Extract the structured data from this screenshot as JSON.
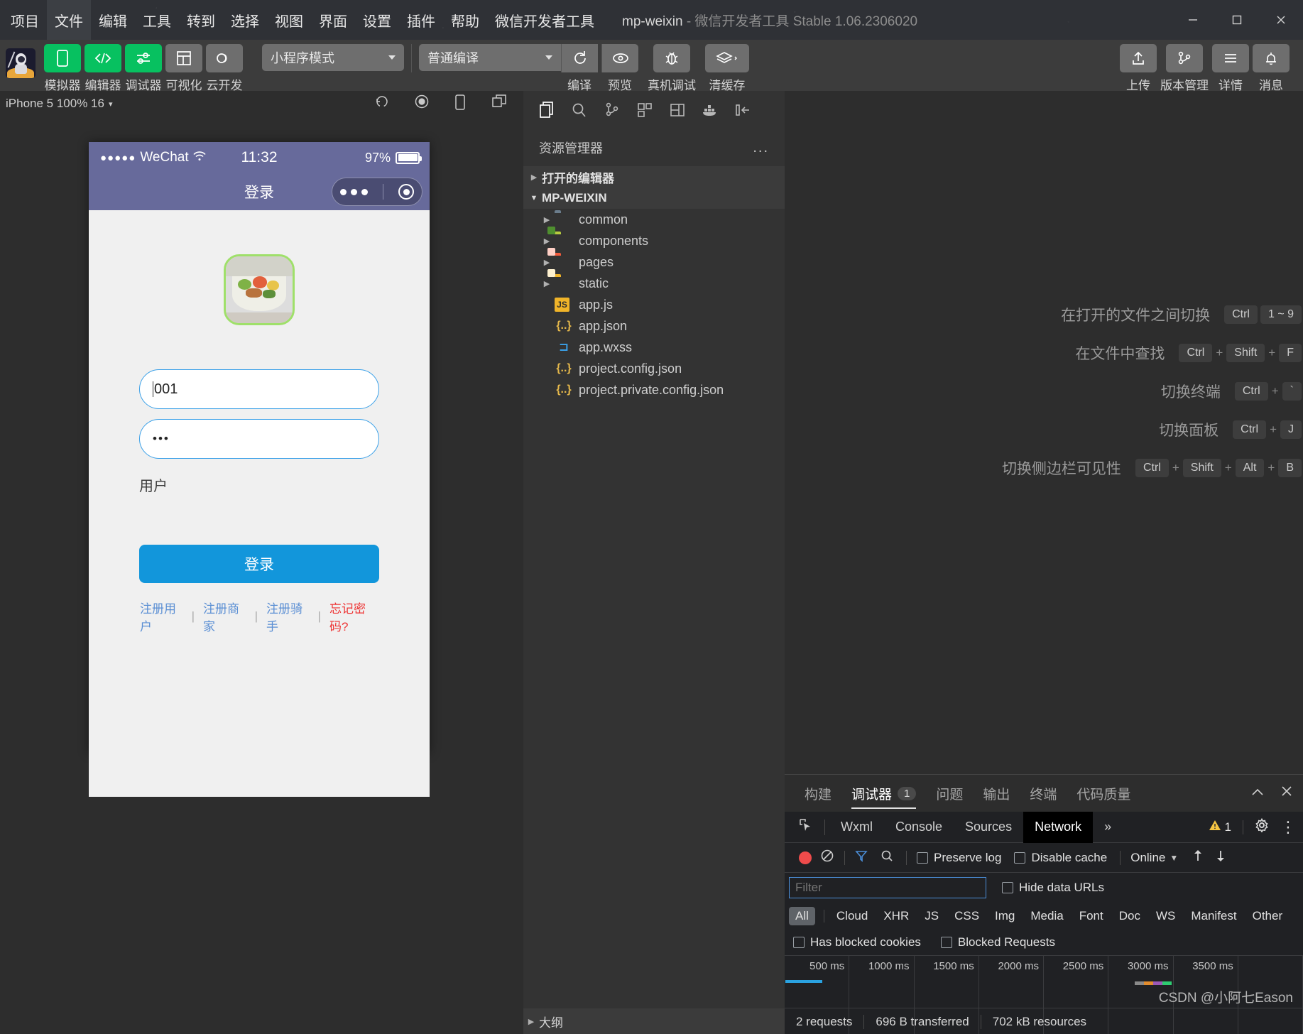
{
  "titlebar": {
    "menus": [
      "项目",
      "文件",
      "编辑",
      "工具",
      "转到",
      "选择",
      "视图",
      "界面",
      "设置",
      "插件",
      "帮助",
      "微信开发者工具"
    ],
    "active_menu": "文件",
    "project_name": "mp-weixin",
    "title_suffix": "- 微信开发者工具 Stable 1.06.2306020",
    "window_minimize": "—",
    "window_maximize": "▢",
    "window_close": "✕"
  },
  "toolbar": {
    "left_buttons": [
      {
        "label": "模拟器",
        "icon": "phone-icon",
        "color": "green"
      },
      {
        "label": "编辑器",
        "icon": "code-icon",
        "color": "green"
      },
      {
        "label": "调试器",
        "icon": "sliders-icon",
        "color": "green"
      },
      {
        "label": "可视化",
        "icon": "layout-icon",
        "color": "grey"
      },
      {
        "label": "云开发",
        "icon": "cloud-icon",
        "color": "grey"
      }
    ],
    "mode_select": "小程序模式",
    "compile_select": "普通编译",
    "actions": [
      {
        "label": "编译",
        "icon": "refresh-icon"
      },
      {
        "label": "预览",
        "icon": "eye-icon"
      },
      {
        "label": "真机调试",
        "icon": "bug-icon"
      },
      {
        "label": "清缓存",
        "icon": "layers-icon"
      }
    ],
    "right_buttons": [
      {
        "label": "上传",
        "icon": "upload-icon"
      },
      {
        "label": "版本管理",
        "icon": "branch-icon"
      },
      {
        "label": "详情",
        "icon": "menu-icon"
      },
      {
        "label": "消息",
        "icon": "bell-icon"
      }
    ]
  },
  "simulator": {
    "device_info": "iPhone 5 100% 16",
    "toolbar_icons": [
      "rotate-icon",
      "record-icon",
      "device-icon",
      "window-icon"
    ],
    "status_bar": {
      "carrier_dots": "●●●●●",
      "carrier": "WeChat",
      "wifi": "wifi-icon",
      "time": "11:32",
      "battery_pct": "97%"
    },
    "nav_title": "登录",
    "form": {
      "username_value": "001",
      "password_value": "•••",
      "user_label": "用户",
      "login_button": "登录"
    },
    "links": [
      {
        "label": "注册用户",
        "style": "normal"
      },
      {
        "label": "注册商家",
        "style": "normal"
      },
      {
        "label": "注册骑手",
        "style": "normal"
      },
      {
        "label": "忘记密码?",
        "style": "warn"
      }
    ]
  },
  "explorer": {
    "activity_icons": [
      "files-icon",
      "search-icon",
      "source-control-icon",
      "extensions-icon",
      "layout-icon",
      "docker-icon",
      "collapse-icon"
    ],
    "title": "资源管理器",
    "more_label": "...",
    "sections": [
      {
        "label": "打开的编辑器",
        "expanded": false
      },
      {
        "label": "MP-WEIXIN",
        "expanded": true
      }
    ],
    "tree": [
      {
        "label": "common",
        "type": "folder",
        "color": "#6b7d8c",
        "expanded": false
      },
      {
        "label": "components",
        "type": "folder",
        "color": "#b7cc3f",
        "expanded": false
      },
      {
        "label": "pages",
        "type": "folder",
        "color": "#f45b3c",
        "expanded": false
      },
      {
        "label": "static",
        "type": "folder",
        "color": "#f0b429",
        "expanded": false
      },
      {
        "label": "app.js",
        "type": "js",
        "color": "#f0b429"
      },
      {
        "label": "app.json",
        "type": "json",
        "color": "#e5b84b"
      },
      {
        "label": "app.wxss",
        "type": "wxss",
        "color": "#3aa0e8"
      },
      {
        "label": "project.config.json",
        "type": "json",
        "color": "#e5b84b"
      },
      {
        "label": "project.private.config.json",
        "type": "json",
        "color": "#e5b84b"
      }
    ],
    "outline_label": "大纲"
  },
  "editor_hints": [
    {
      "label": "在打开的文件之间切换",
      "keys": [
        "Ctrl",
        "1 ~ 9"
      ],
      "joined": false
    },
    {
      "label": "在文件中查找",
      "keys": [
        "Ctrl",
        "Shift",
        "F"
      ],
      "joined": true
    },
    {
      "label": "切换终端",
      "keys": [
        "Ctrl",
        "`"
      ],
      "joined": true
    },
    {
      "label": "切换面板",
      "keys": [
        "Ctrl",
        "J"
      ],
      "joined": true
    },
    {
      "label": "切换侧边栏可见性",
      "keys": [
        "Ctrl",
        "Shift",
        "Alt",
        "B"
      ],
      "joined": true
    }
  ],
  "devtools": {
    "panel_tabs": [
      {
        "label": "构建",
        "active": false
      },
      {
        "label": "调试器",
        "active": true,
        "badge": "1"
      },
      {
        "label": "问题",
        "active": false
      },
      {
        "label": "输出",
        "active": false
      },
      {
        "label": "终端",
        "active": false
      },
      {
        "label": "代码质量",
        "active": false
      }
    ],
    "panel_actions": [
      "chevron-up-icon",
      "close-icon"
    ],
    "cdt_tabs": [
      {
        "label": "Wxml",
        "selected": false
      },
      {
        "label": "Console",
        "selected": false
      },
      {
        "label": "Sources",
        "selected": false
      },
      {
        "label": "Network",
        "selected": true
      },
      {
        "label": "»",
        "selected": false
      }
    ],
    "warning_count": "1",
    "network": {
      "preserve_log": "Preserve log",
      "disable_cache": "Disable cache",
      "throttling": "Online",
      "filter_placeholder": "Filter",
      "hide_data_urls": "Hide data URLs",
      "types": [
        "All",
        "Cloud",
        "XHR",
        "JS",
        "CSS",
        "Img",
        "Media",
        "Font",
        "Doc",
        "WS",
        "Manifest",
        "Other"
      ],
      "selected_type": "All",
      "has_blocked_cookies": "Has blocked cookies",
      "blocked_requests": "Blocked Requests",
      "timeline_ticks": [
        "500 ms",
        "1000 ms",
        "1500 ms",
        "2000 ms",
        "2500 ms",
        "3000 ms",
        "3500 ms"
      ],
      "status": [
        "2 requests",
        "696 B transferred",
        "702 kB resources"
      ]
    }
  },
  "watermark": "CSDN @小阿七Eason"
}
